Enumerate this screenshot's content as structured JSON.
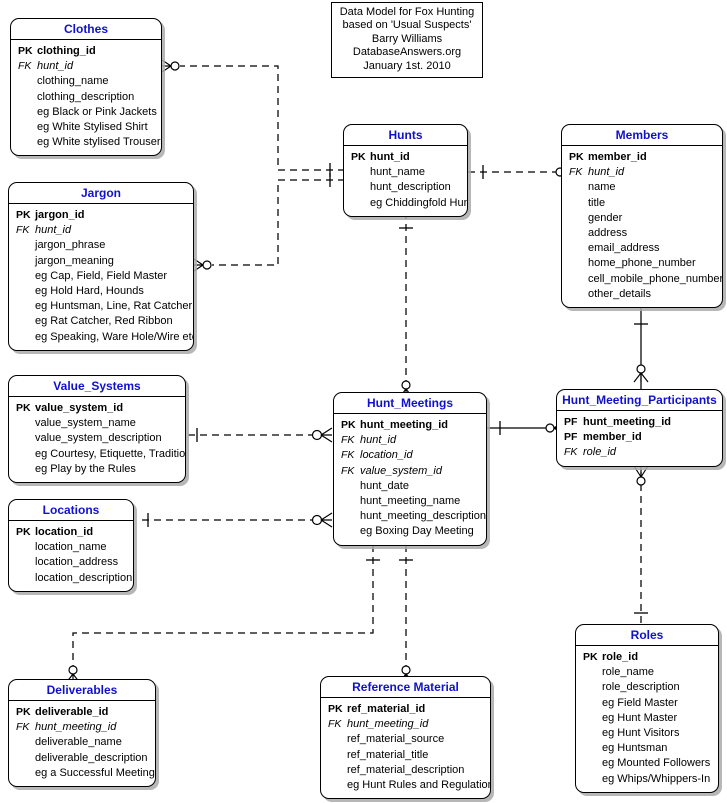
{
  "diagram": {
    "note": {
      "lines": [
        "Data Model for Fox Hunting",
        "based on 'Usual Suspects'",
        "Barry Williams",
        "DatabaseAnswers.org",
        "January 1st. 2010"
      ]
    },
    "title_color": "#1111cc",
    "line_color": "#000000",
    "background": "#ffffff",
    "entities": [
      {
        "id": "clothes",
        "name": "Clothes",
        "attributes": [
          {
            "key": "PK",
            "name": "clothing_id"
          },
          {
            "key": "FK",
            "name": "hunt_id"
          },
          {
            "key": "",
            "name": "clothing_name"
          },
          {
            "key": "",
            "name": "clothing_description"
          },
          {
            "key": "",
            "name": "eg Black or Pink Jackets"
          },
          {
            "key": "",
            "name": "eg White Stylised Shirt"
          },
          {
            "key": "",
            "name": "eg White stylised Trousers"
          }
        ]
      },
      {
        "id": "jargon",
        "name": "Jargon",
        "attributes": [
          {
            "key": "PK",
            "name": "jargon_id"
          },
          {
            "key": "FK",
            "name": "hunt_id"
          },
          {
            "key": "",
            "name": "jargon_phrase"
          },
          {
            "key": "",
            "name": "jargon_meaning"
          },
          {
            "key": "",
            "name": "eg Cap, Field, Field Master"
          },
          {
            "key": "",
            "name": "eg Hold Hard, Hounds"
          },
          {
            "key": "",
            "name": "eg Huntsman, Line, Rat Catcher"
          },
          {
            "key": "",
            "name": "eg Rat Catcher, Red Ribbon"
          },
          {
            "key": "",
            "name": "eg Speaking, Ware Hole/Wire etc"
          }
        ]
      },
      {
        "id": "value_systems",
        "name": "Value_Systems",
        "attributes": [
          {
            "key": "PK",
            "name": "value_system_id"
          },
          {
            "key": "",
            "name": "value_system_name"
          },
          {
            "key": "",
            "name": "value_system_description"
          },
          {
            "key": "",
            "name": "eg Courtesy, Etiquette, Tradition"
          },
          {
            "key": "",
            "name": "eg Play by the Rules"
          }
        ]
      },
      {
        "id": "locations",
        "name": "Locations",
        "attributes": [
          {
            "key": "PK",
            "name": "location_id"
          },
          {
            "key": "",
            "name": "location_name"
          },
          {
            "key": "",
            "name": "location_address"
          },
          {
            "key": "",
            "name": "location_description"
          }
        ]
      },
      {
        "id": "deliverables",
        "name": "Deliverables",
        "attributes": [
          {
            "key": "PK",
            "name": "deliverable_id"
          },
          {
            "key": "FK",
            "name": "hunt_meeting_id"
          },
          {
            "key": "",
            "name": "deliverable_name"
          },
          {
            "key": "",
            "name": "deliverable_description"
          },
          {
            "key": "",
            "name": "eg a Successful Meeting"
          }
        ]
      },
      {
        "id": "hunts",
        "name": "Hunts",
        "attributes": [
          {
            "key": "PK",
            "name": "hunt_id"
          },
          {
            "key": "",
            "name": "hunt_name"
          },
          {
            "key": "",
            "name": "hunt_description"
          },
          {
            "key": "",
            "name": "eg Chiddingfold Hunt"
          }
        ]
      },
      {
        "id": "hunt_meetings",
        "name": "Hunt_Meetings",
        "attributes": [
          {
            "key": "PK",
            "name": "hunt_meeting_id"
          },
          {
            "key": "FK",
            "name": "hunt_id"
          },
          {
            "key": "FK",
            "name": "location_id"
          },
          {
            "key": "FK",
            "name": "value_system_id"
          },
          {
            "key": "",
            "name": "hunt_date"
          },
          {
            "key": "",
            "name": "hunt_meeting_name"
          },
          {
            "key": "",
            "name": "hunt_meeting_description"
          },
          {
            "key": "",
            "name": "eg Boxing Day Meeting"
          }
        ]
      },
      {
        "id": "reference_material",
        "name": "Reference Material",
        "attributes": [
          {
            "key": "PK",
            "name": "ref_material_id"
          },
          {
            "key": "FK",
            "name": "hunt_meeting_id"
          },
          {
            "key": "",
            "name": "ref_material_source"
          },
          {
            "key": "",
            "name": "ref_material_title"
          },
          {
            "key": "",
            "name": "ref_material_description"
          },
          {
            "key": "",
            "name": "eg Hunt Rules and Regulations"
          }
        ]
      },
      {
        "id": "members",
        "name": "Members",
        "attributes": [
          {
            "key": "PK",
            "name": "member_id"
          },
          {
            "key": "FK",
            "name": "hunt_id"
          },
          {
            "key": "",
            "name": "name"
          },
          {
            "key": "",
            "name": "title"
          },
          {
            "key": "",
            "name": "gender"
          },
          {
            "key": "",
            "name": "address"
          },
          {
            "key": "",
            "name": "email_address"
          },
          {
            "key": "",
            "name": "home_phone_number"
          },
          {
            "key": "",
            "name": "cell_mobile_phone_number"
          },
          {
            "key": "",
            "name": "other_details"
          }
        ]
      },
      {
        "id": "hunt_meeting_participants",
        "name": "Hunt_Meeting_Participants",
        "attributes": [
          {
            "key": "PF",
            "name": "hunt_meeting_id"
          },
          {
            "key": "PF",
            "name": "member_id"
          },
          {
            "key": "FK",
            "name": "role_id"
          }
        ]
      },
      {
        "id": "roles",
        "name": "Roles",
        "attributes": [
          {
            "key": "PK",
            "name": "role_id"
          },
          {
            "key": "",
            "name": "role_name"
          },
          {
            "key": "",
            "name": "role_description"
          },
          {
            "key": "",
            "name": "eg Field Master"
          },
          {
            "key": "",
            "name": "eg Hunt Master"
          },
          {
            "key": "",
            "name": "eg Hunt Visitors"
          },
          {
            "key": "",
            "name": "eg Huntsman"
          },
          {
            "key": "",
            "name": "eg Mounted Followers"
          },
          {
            "key": "",
            "name": "eg Whips/Whippers-In"
          }
        ]
      }
    ],
    "relationships": [
      {
        "from": "hunts",
        "to": "clothes",
        "style": "dashed",
        "from_card": "one",
        "to_card": "zero-or-many"
      },
      {
        "from": "hunts",
        "to": "jargon",
        "style": "dashed",
        "from_card": "one",
        "to_card": "zero-or-many"
      },
      {
        "from": "hunts",
        "to": "members",
        "style": "dashed",
        "from_card": "one",
        "to_card": "zero-or-many"
      },
      {
        "from": "hunts",
        "to": "hunt_meetings",
        "style": "dashed",
        "from_card": "one",
        "to_card": "zero-or-many"
      },
      {
        "from": "value_systems",
        "to": "hunt_meetings",
        "style": "dashed",
        "from_card": "one",
        "to_card": "zero-or-many"
      },
      {
        "from": "locations",
        "to": "hunt_meetings",
        "style": "dashed",
        "from_card": "one",
        "to_card": "zero-or-many"
      },
      {
        "from": "hunt_meetings",
        "to": "hunt_meeting_participants",
        "style": "solid",
        "from_card": "one",
        "to_card": "zero-or-many"
      },
      {
        "from": "members",
        "to": "hunt_meeting_participants",
        "style": "solid",
        "from_card": "one",
        "to_card": "zero-or-many"
      },
      {
        "from": "roles",
        "to": "hunt_meeting_participants",
        "style": "dashed",
        "from_card": "one",
        "to_card": "zero-or-many"
      },
      {
        "from": "hunt_meetings",
        "to": "deliverables",
        "style": "dashed",
        "from_card": "one",
        "to_card": "zero-or-many"
      },
      {
        "from": "hunt_meetings",
        "to": "reference_material",
        "style": "dashed",
        "from_card": "one",
        "to_card": "zero-or-many"
      }
    ]
  }
}
